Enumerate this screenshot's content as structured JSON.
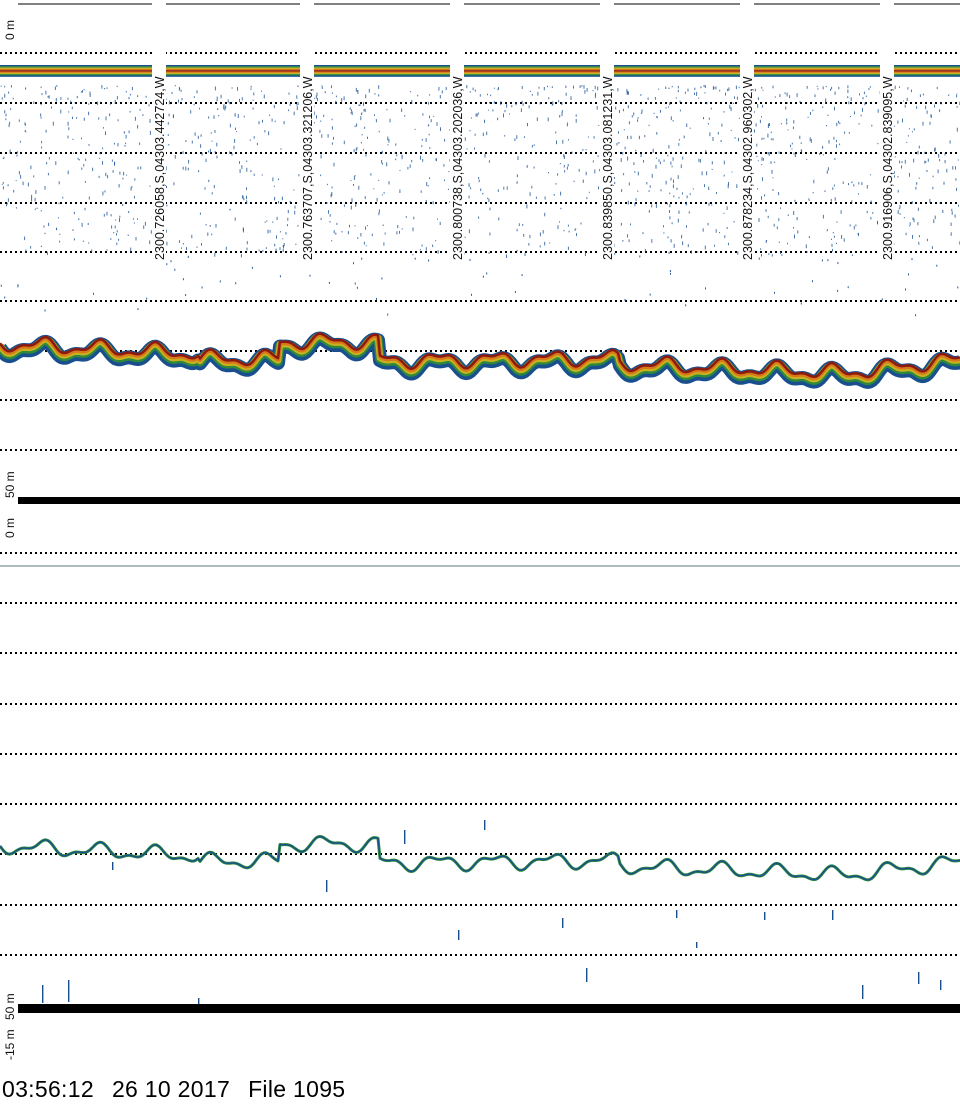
{
  "upper_panel": {
    "scale_top_label": "0 m",
    "scale_bottom_label": "50 m",
    "position_labels": [
      "2300.726058,S,04303.442724,W",
      "2300.763707,S,04303.321206,W",
      "2300.800738,S,04303.202036,W",
      "2300.839850,S,04303.081231,W",
      "2300.878234,S,04302.960302,W",
      "2300.916906,S,04302.839095,W"
    ]
  },
  "lower_panel": {
    "scale_top_label": "0 m",
    "scale_bottom_label": "50 m",
    "offset_label": "-15 m"
  },
  "footer": {
    "time": "03:56:12",
    "date": "26 10 2017",
    "file_label": "File 1095"
  },
  "colors": {
    "background": "#ffffff",
    "grid": "#000000",
    "echo_strong": "#8b1a10",
    "echo_orange": "#d8781a",
    "echo_yellow": "#c8b020",
    "echo_green": "#2e8a3a",
    "echo_blue": "#1a4f8f",
    "scatter": "#2a5f9e"
  }
}
